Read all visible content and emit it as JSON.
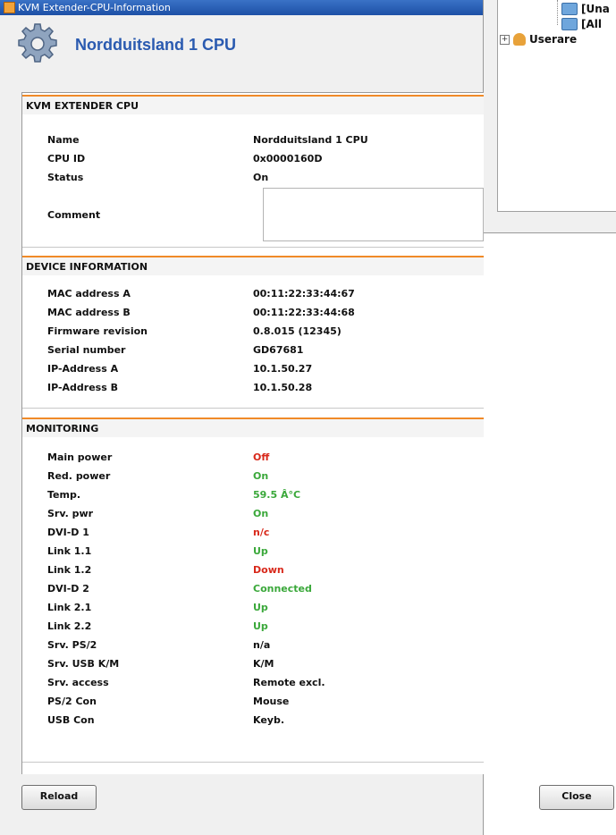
{
  "window": {
    "title": "KVM Extender-CPU-Information",
    "header_title": "Nordduitsland 1 CPU"
  },
  "background_tree": {
    "items": [
      {
        "label": "[Una"
      },
      {
        "label": "[All"
      },
      {
        "label": "Userare"
      }
    ]
  },
  "sections": {
    "cpu": {
      "title": "KVM EXTENDER CPU",
      "rows": [
        {
          "label": "Name",
          "value": "Nordduitsland 1 CPU"
        },
        {
          "label": "CPU ID",
          "value": "0x0000160D"
        },
        {
          "label": "Status",
          "value": "On"
        }
      ],
      "comment_label": "Comment",
      "comment_value": ""
    },
    "device": {
      "title": "DEVICE INFORMATION",
      "rows": [
        {
          "label": "MAC address A",
          "value": "00:11:22:33:44:67"
        },
        {
          "label": "MAC address B",
          "value": "00:11:22:33:44:68"
        },
        {
          "label": "Firmware revision",
          "value": "0.8.015 (12345)"
        },
        {
          "label": "Serial number",
          "value": "GD67681"
        },
        {
          "label": "IP-Address A",
          "value": "10.1.50.27"
        },
        {
          "label": "IP-Address B",
          "value": "10.1.50.28"
        }
      ]
    },
    "monitoring": {
      "title": "MONITORING",
      "rows": [
        {
          "label": "Main power",
          "value": "Off"
        },
        {
          "label": "Red. power",
          "value": "On"
        },
        {
          "label": "Temp.",
          "value": "59.5 Â°C"
        },
        {
          "label": "Srv. pwr",
          "value": "On"
        },
        {
          "label": "DVI-D 1",
          "value": "n/c"
        },
        {
          "label": "Link 1.1",
          "value": "Up"
        },
        {
          "label": "Link 1.2",
          "value": "Down"
        },
        {
          "label": "DVI-D 2",
          "value": "Connected"
        },
        {
          "label": "Link 2.1",
          "value": "Up"
        },
        {
          "label": "Link 2.2",
          "value": "Up"
        },
        {
          "label": "Srv. PS/2",
          "value": "n/a"
        },
        {
          "label": "Srv. USB K/M",
          "value": "K/M"
        },
        {
          "label": "Srv. access",
          "value": "Remote excl."
        },
        {
          "label": "PS/2 Con",
          "value": "Mouse"
        },
        {
          "label": "USB Con",
          "value": "Keyb."
        }
      ]
    }
  },
  "buttons": {
    "reload": "Reload",
    "close": "Close"
  },
  "colors": {
    "accent_orange": "#f08a28",
    "status_red": "#d8281a",
    "status_green": "#3aa83a",
    "title_blue": "#2a5ab0"
  },
  "icons": {
    "title": "gear-icon",
    "app": "kvm-app-icon"
  }
}
